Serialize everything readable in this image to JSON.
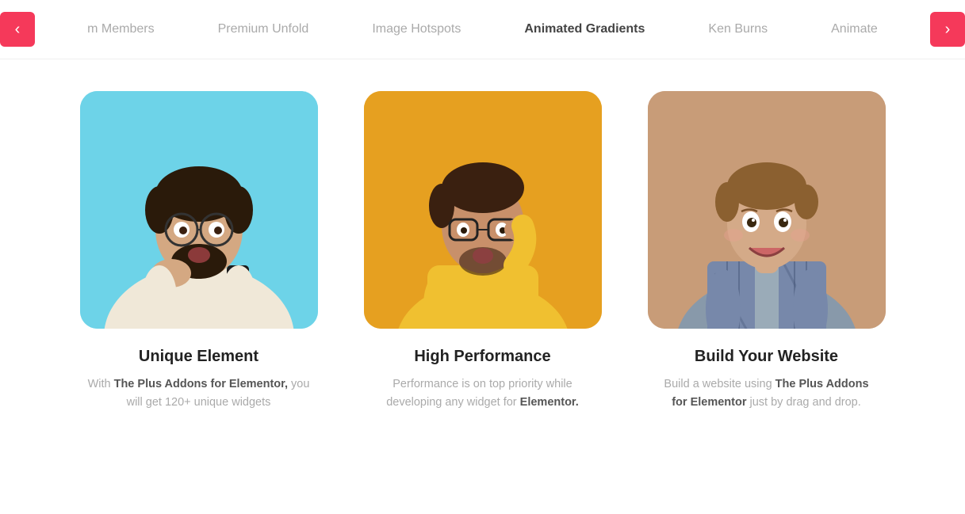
{
  "nav": {
    "prev_label": "‹",
    "next_label": "›",
    "items": [
      {
        "label": "m Members",
        "active": false
      },
      {
        "label": "Premium Unfold",
        "active": false
      },
      {
        "label": "Image Hotspots",
        "active": false
      },
      {
        "label": "Animated Gradients",
        "active": true
      },
      {
        "label": "Ken Burns",
        "active": false
      },
      {
        "label": "Animate",
        "active": false
      }
    ]
  },
  "cards": [
    {
      "title": "Unique Element",
      "desc_parts": [
        {
          "text": "With ",
          "bold": false
        },
        {
          "text": "The Plus Addons for Elementor,",
          "bold": true
        },
        {
          "text": " you will get 120+ unique widgets",
          "bold": false
        }
      ],
      "bg_color": "#6dd3e8"
    },
    {
      "title": "High Performance",
      "desc_parts": [
        {
          "text": "Performance is on top priority while developing any widget for ",
          "bold": false
        },
        {
          "text": "Elementor.",
          "bold": true
        }
      ],
      "bg_color": "#e6a020"
    },
    {
      "title": "Build Your Website",
      "desc_parts": [
        {
          "text": "Build a website using ",
          "bold": false
        },
        {
          "text": "The Plus Addons for Elementor",
          "bold": true
        },
        {
          "text": " just by drag and drop.",
          "bold": false
        }
      ],
      "bg_color": "#c89c78"
    }
  ],
  "colors": {
    "accent": "#f5395a",
    "nav_active": "#444",
    "nav_inactive": "#aaa"
  }
}
